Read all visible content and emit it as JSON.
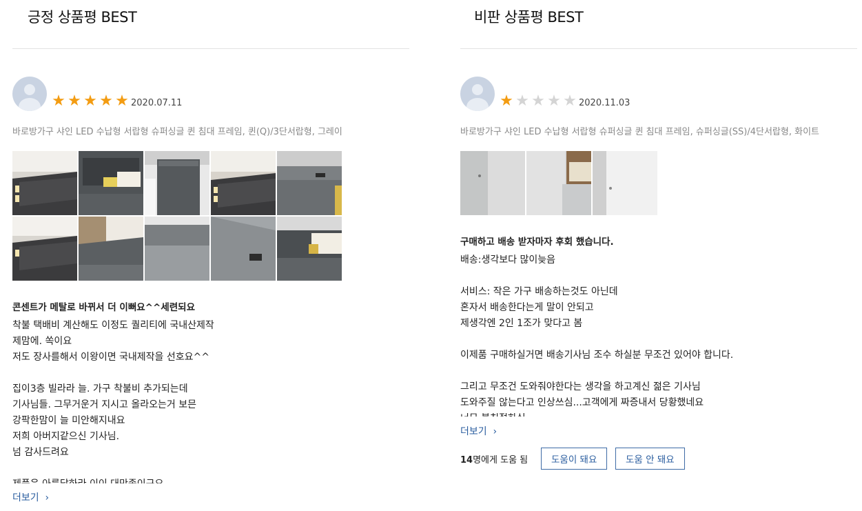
{
  "positive": {
    "title": "긍정 상품평 BEST",
    "rating": 5,
    "date": "2020.07.11",
    "product": "바로방가구 샤인 LED 수납형 서랍형 슈퍼싱글 퀸 침대 프레임, 퀸(Q)/3단서랍형, 그레이",
    "review_title": "콘센트가 메탈로 바뀌서 더 이뻐요^^세련되요",
    "review_body": "착불 택배비 계산해도 이정도 퀄리티에 국내산제작\n제맘에. 쏙이요\n저도 장사를해서 이왕이면 국내제작을 선호요^^\n\n집이3층 빌라라 늘. 가구 착불비 추가되는데\n기사님들. 그무거운거 지시고 올라오는거 보믄\n강팍한맘이 늘 미안해지내요\n저희 아버지같으신 기사님.\n넘 감사드려요\n\n제품은 아름답하라 이이 대만족이구요",
    "more_label": "더보기",
    "photo_count": 10
  },
  "negative": {
    "title": "비판 상품평 BEST",
    "rating": 1,
    "date": "2020.11.03",
    "product": "바로방가구 샤인 LED 수납형 서랍형 슈퍼싱글 퀸 침대 프레임, 슈퍼싱글(SS)/4단서랍형, 화이트",
    "review_title": "구매하고 배송 받자마자 후회 했습니다.",
    "review_body": "배송:생각보다 많이늦음\n\n서비스: 작은 가구 배송하는것도 아닌데\n혼자서 배송한다는게 말이 안되고\n제생각엔 2인 1조가 맞다고 봄\n\n이제품 구매하실거면 배송기사님 조수 하실분 무조건 있어야 합니다.\n\n그리고 무조건 도와줘야한다는 생각을 하고계신 젊은 기사님\n도와주질 않는다고 인상쓰심...고객에게 짜증내서 당황했네요\n너무 불친절하심",
    "more_label": "더보기",
    "photo_count": 3,
    "helpful_count": "14",
    "helpful_suffix": "명에게 도움 됨",
    "helpful_yes": "도움이 돼요",
    "helpful_no": "도움 안 돼요"
  },
  "colors": {
    "star_on": "#f39c12",
    "star_off": "#d4d4d4",
    "link": "#2a5d9f"
  }
}
